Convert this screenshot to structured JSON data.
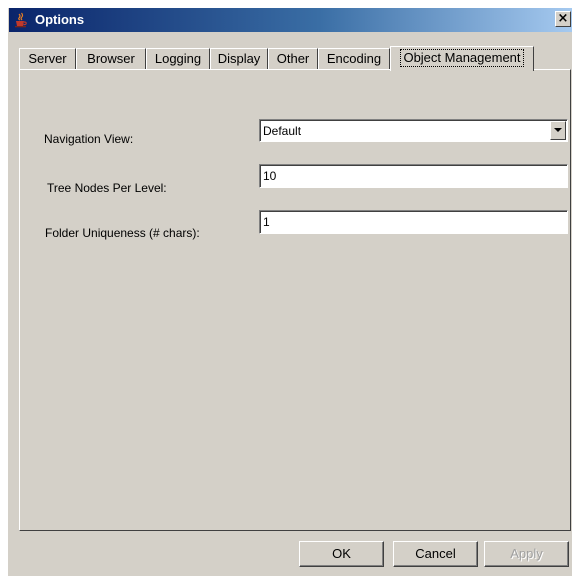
{
  "window": {
    "title": "Options",
    "close_glyph": "×",
    "icon": "java-cup-icon"
  },
  "tabs": [
    {
      "label": "Server",
      "active": false
    },
    {
      "label": "Browser",
      "active": false
    },
    {
      "label": "Logging",
      "active": false
    },
    {
      "label": "Display",
      "active": false
    },
    {
      "label": "Other",
      "active": false
    },
    {
      "label": "Encoding",
      "active": false
    },
    {
      "label": "Object Management",
      "active": true
    }
  ],
  "form": {
    "navigation_view": {
      "label": "Navigation View:",
      "value": "Default"
    },
    "tree_nodes_per_level": {
      "label": "Tree Nodes Per Level:",
      "value": "10"
    },
    "folder_uniqueness": {
      "label": "Folder Uniqueness (# chars):",
      "value": "1"
    }
  },
  "buttons": {
    "ok": "OK",
    "cancel": "Cancel",
    "apply": "Apply"
  },
  "colors": {
    "dialog_face": "#d4d0c8",
    "titlebar_start": "#0a246a",
    "titlebar_end": "#a6caf0"
  }
}
